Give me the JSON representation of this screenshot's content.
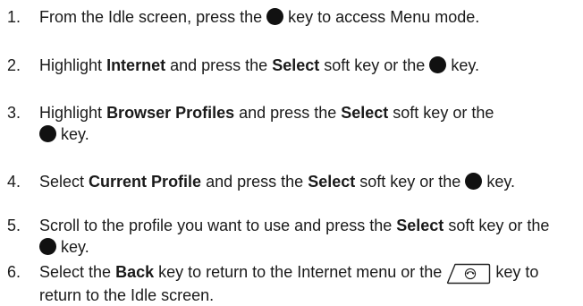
{
  "steps": [
    {
      "number": "1.",
      "pre": "From the Idle screen, press the",
      "post": "key to access Menu mode."
    },
    {
      "number": "2.",
      "pre": "Highlight",
      "b1": "Internet",
      "mid": "and press the",
      "b2": "Select",
      "post": "soft key or the",
      "end": "key."
    },
    {
      "number": "3.",
      "pre": "Highlight",
      "b1": "Browser Profiles",
      "mid": "and press the",
      "b2": "Select",
      "post": "soft key or the",
      "end": "key."
    },
    {
      "number": "4.",
      "pre": "Select",
      "b1": "Current Profile",
      "mid": "and press the",
      "b2": "Select",
      "post": "soft key or the",
      "end": "key."
    },
    {
      "number": "5.",
      "pre": "Scroll to the profile you want to use and press the",
      "b1": "Select",
      "post": "soft key or the",
      "end": "key."
    },
    {
      "number": "6.",
      "pre": "Select the",
      "b1": "Back",
      "mid": "key to return to the Internet menu or the",
      "end": "key to",
      "end2": "return to the Idle screen."
    }
  ],
  "icons": {
    "ok_key": "ok-key-icon",
    "end_key": "end-call-key-icon"
  }
}
